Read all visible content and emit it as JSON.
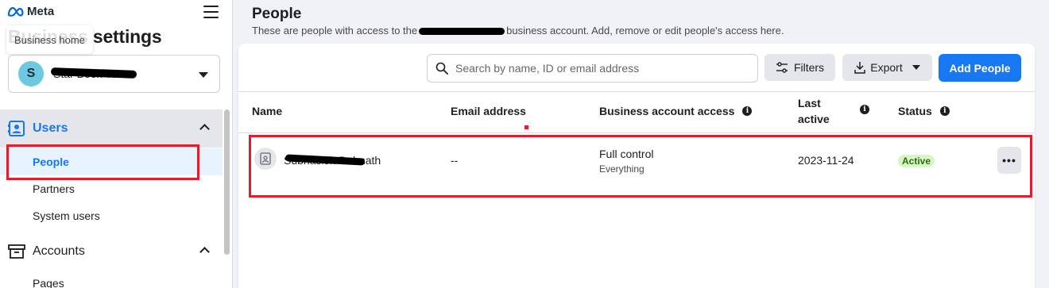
{
  "brand": {
    "logo_text": "Meta"
  },
  "sidebar": {
    "title": "Business settings",
    "tooltip": "Business home",
    "account": {
      "avatar_letter": "S",
      "name": "Star Book Tours"
    },
    "sections": [
      {
        "label": "Users",
        "expanded": true,
        "items": [
          {
            "label": "People",
            "selected": true
          },
          {
            "label": "Partners"
          },
          {
            "label": "System users"
          }
        ]
      },
      {
        "label": "Accounts",
        "expanded": true,
        "items": [
          {
            "label": "Pages"
          }
        ]
      }
    ]
  },
  "page": {
    "title": "People",
    "subtitle_before": "These are people with access to the",
    "subtitle_after": "business account. Add, remove or edit people's access here."
  },
  "toolbar": {
    "search_placeholder": "Search by name, ID or email address",
    "filters_label": "Filters",
    "export_label": "Export",
    "add_label": "Add People"
  },
  "table": {
    "columns": {
      "name": "Name",
      "email": "Email address",
      "access": "Business account access",
      "last_active_1": "Last",
      "last_active_2": "active",
      "status": "Status"
    },
    "rows": [
      {
        "name": "Subhasish Debnath",
        "email": "--",
        "access": "Full control",
        "access_detail": "Everything",
        "last_active": "2023-11-24",
        "status": "Active"
      }
    ]
  },
  "colors": {
    "accent": "#1877f2",
    "highlight_box": "#e11d2e",
    "status_active_bg": "#d8f5c4"
  },
  "icons": [
    "meta-logo-icon",
    "menu-icon",
    "users-icon",
    "chevron-up-icon",
    "archive-icon",
    "search-icon",
    "filters-icon",
    "download-icon",
    "info-icon",
    "id-card-icon",
    "more-icon"
  ]
}
